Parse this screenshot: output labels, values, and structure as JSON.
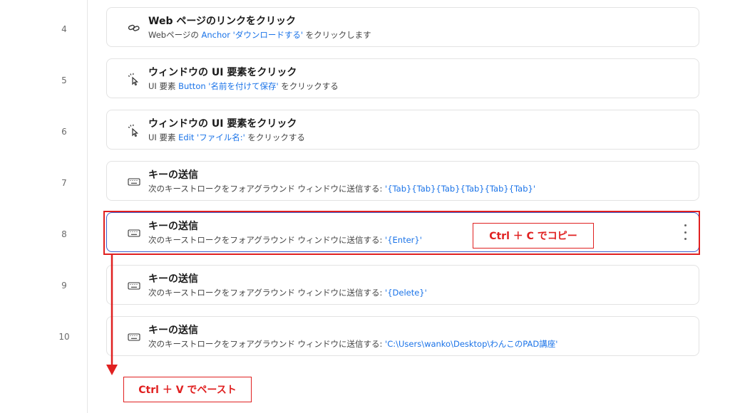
{
  "steps": [
    {
      "num": "4",
      "icon": "link-icon",
      "title": "Web ページのリンクをクリック",
      "desc_pre": "Webページの ",
      "desc_hl": "Anchor 'ダウンロードする'",
      "desc_post": " をクリックします"
    },
    {
      "num": "5",
      "icon": "click-cursor-icon",
      "title": "ウィンドウの UI 要素をクリック",
      "desc_pre": "UI 要素 ",
      "desc_hl": "Button '名前を付けて保存'",
      "desc_post": " をクリックする"
    },
    {
      "num": "6",
      "icon": "click-cursor-icon",
      "title": "ウィンドウの UI 要素をクリック",
      "desc_pre": "UI 要素 ",
      "desc_hl": "Edit 'ファイル名:'",
      "desc_post": " をクリックする"
    },
    {
      "num": "7",
      "icon": "keyboard-icon",
      "title": "キーの送信",
      "desc_pre": "次のキーストロークをフォアグラウンド ウィンドウに送信する: ",
      "desc_hl": "'{Tab}{Tab}{Tab}{Tab}{Tab}{Tab}'",
      "desc_post": ""
    },
    {
      "num": "8",
      "icon": "keyboard-icon",
      "title": "キーの送信",
      "desc_pre": "次のキーストロークをフォアグラウンド ウィンドウに送信する: ",
      "desc_hl": "'{Enter}'",
      "desc_post": ""
    },
    {
      "num": "9",
      "icon": "keyboard-icon",
      "title": "キーの送信",
      "desc_pre": "次のキーストロークをフォアグラウンド ウィンドウに送信する: ",
      "desc_hl": "'{Delete}'",
      "desc_post": ""
    },
    {
      "num": "10",
      "icon": "keyboard-icon",
      "title": "キーの送信",
      "desc_pre": "次のキーストロークをフォアグラウンド ウィンドウに送信する: ",
      "desc_hl": "'C:\\Users\\wanko\\Desktop\\わんこのPAD講座'",
      "desc_post": ""
    }
  ],
  "annotations": {
    "copy": "Ctrl ＋ C でコピー",
    "paste": "Ctrl ＋ V でペースト"
  },
  "colors": {
    "accent_link": "#1a73e8",
    "annotation_red": "#e02020",
    "selected_border": "#3f5fd0"
  }
}
